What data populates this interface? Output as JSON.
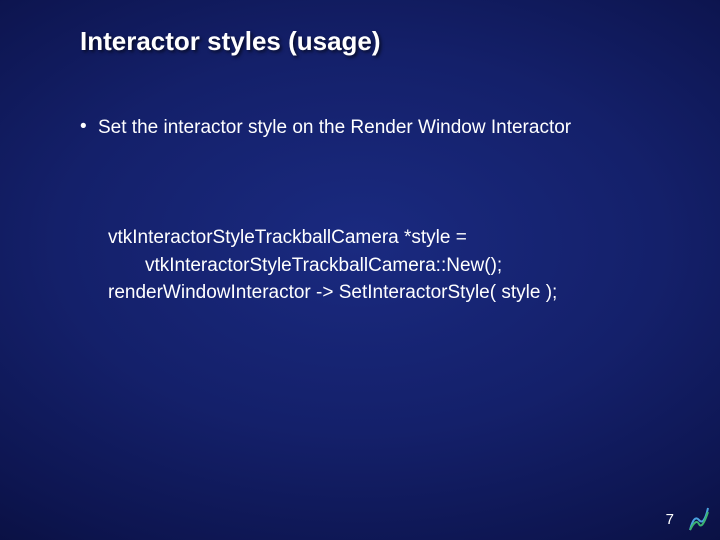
{
  "title": "Interactor styles (usage)",
  "bullet": {
    "marker": "•",
    "text": "Set the interactor style on the Render Window Interactor"
  },
  "code": {
    "line1": "vtkInteractorStyleTrackballCamera *style =",
    "line2": "       vtkInteractorStyleTrackballCamera::New();",
    "line3": "renderWindowInteractor -> SetInteractorStyle( style );"
  },
  "page_number": "7"
}
